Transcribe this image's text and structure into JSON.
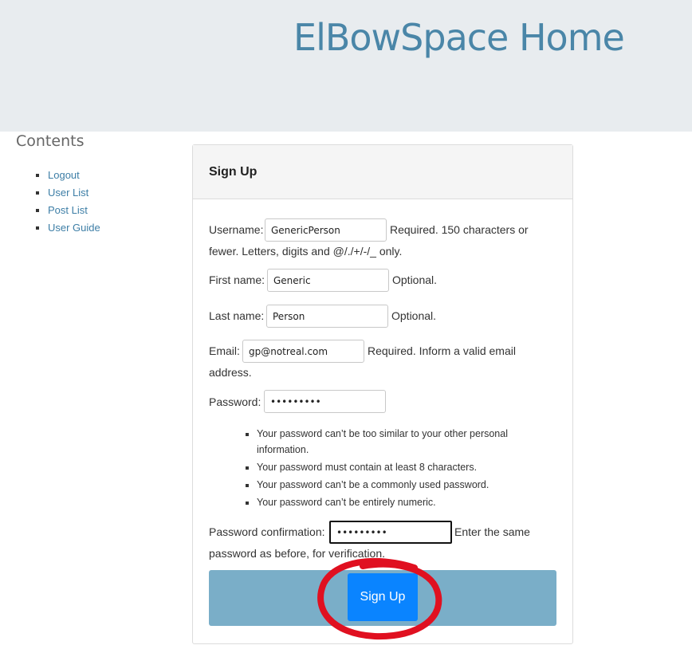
{
  "header": {
    "title": "ElBowSpace Home"
  },
  "sidebar": {
    "title": "Contents",
    "links": [
      {
        "label": "Logout"
      },
      {
        "label": "User List"
      },
      {
        "label": "Post List"
      },
      {
        "label": "User Guide"
      }
    ]
  },
  "form": {
    "title": "Sign Up",
    "username": {
      "label": "Username:",
      "value": "GenericPerson",
      "help_line1": "Required. 150 characters or",
      "help_line2": "fewer. Letters, digits and @/./+/-/_ only."
    },
    "first_name": {
      "label": "First name:",
      "value": "Generic",
      "help": "Optional."
    },
    "last_name": {
      "label": "Last name:",
      "value": "Person",
      "help": "Optional."
    },
    "email": {
      "label": "Email:",
      "value": "gp@notreal.com",
      "help_line1": "Required. Inform a valid email",
      "help_line2": "address."
    },
    "password": {
      "label": "Password:",
      "value": "•••••••••",
      "rules": [
        "Your password can’t be too similar to your other personal information.",
        "Your password must contain at least 8 characters.",
        "Your password can’t be a commonly used password.",
        "Your password can’t be entirely numeric."
      ]
    },
    "password_confirmation": {
      "label": "Password confirmation:",
      "value": "•••••••••",
      "help_line1": "Enter the same",
      "help_line2": "password as before, for verification."
    },
    "submit_label": "Sign Up"
  },
  "colors": {
    "header_bg": "#e8ecef",
    "title": "#4a86a8",
    "link": "#3d7ea6",
    "submit_bar": "#7aaec8",
    "button": "#0a84ff",
    "annotation": "#e01020"
  },
  "annotation": {
    "shape": "hand-drawn circle",
    "target": "sign-up-button"
  }
}
